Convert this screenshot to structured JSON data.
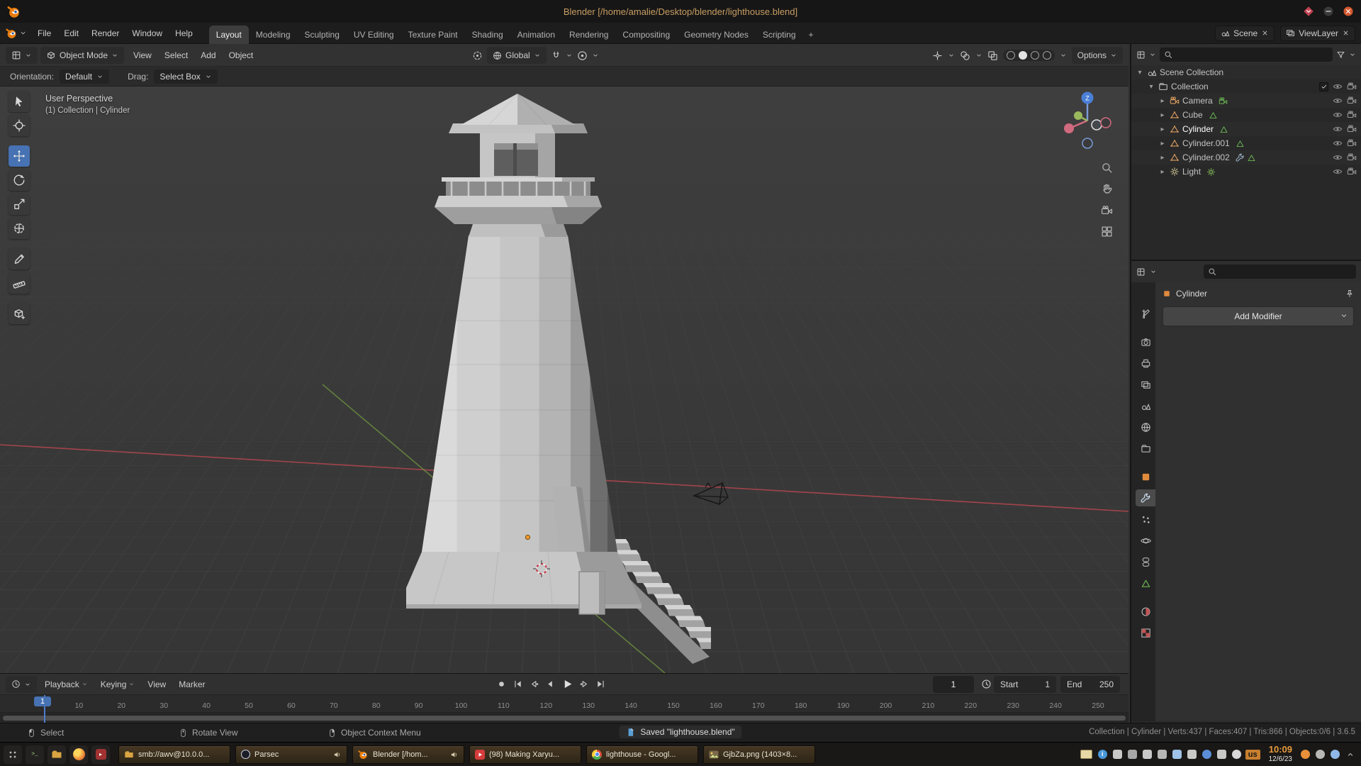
{
  "window": {
    "title": "Blender [/home/amalie/Desktop/blender/lighthouse.blend]"
  },
  "colors": {
    "accent": "#4772b3",
    "brand_orange": "#e87d0d"
  },
  "topbar": {
    "app_menus": [
      "File",
      "Edit",
      "Render",
      "Window",
      "Help"
    ],
    "workspaces": [
      "Layout",
      "Modeling",
      "Sculpting",
      "UV Editing",
      "Texture Paint",
      "Shading",
      "Animation",
      "Rendering",
      "Compositing",
      "Geometry Nodes",
      "Scripting"
    ],
    "active_workspace": "Layout",
    "add_workspace_label": "+",
    "scene_label": "Scene",
    "view_layer_label": "ViewLayer"
  },
  "viewport_header": {
    "mode": "Object Mode",
    "menus": [
      "View",
      "Select",
      "Add",
      "Object"
    ],
    "orientation": "Global",
    "options_label": "Options"
  },
  "tool_settings": {
    "orientation_label": "Orientation:",
    "orientation_value": "Default",
    "drag_label": "Drag:",
    "drag_value": "Select Box"
  },
  "viewport": {
    "overlay_line1": "User Perspective",
    "overlay_line2": "(1) Collection | Cylinder",
    "gizmo_z_label": "Z",
    "tools": [
      {
        "name": "select-box"
      },
      {
        "name": "cursor"
      },
      {
        "name": "move",
        "active": true
      },
      {
        "name": "rotate"
      },
      {
        "name": "scale"
      },
      {
        "name": "transform"
      },
      {
        "name": "annotate"
      },
      {
        "name": "measure"
      },
      {
        "name": "add-cube"
      }
    ],
    "active_tool": "move"
  },
  "outliner": {
    "search_placeholder": "",
    "rows": [
      {
        "label": "Scene Collection",
        "icon": "scene",
        "indent": 0,
        "disclosure": "down",
        "badges": [],
        "right": []
      },
      {
        "label": "Collection",
        "icon": "collection",
        "indent": 1,
        "disclosure": "down",
        "badges": [],
        "right": [
          "check",
          "eye",
          "cam"
        ]
      },
      {
        "label": "Camera",
        "icon": "camera",
        "indent": 2,
        "disclosure": "right",
        "badges": [
          "camera-data"
        ],
        "right": [
          "eye",
          "cam"
        ]
      },
      {
        "label": "Cube",
        "icon": "mesh",
        "indent": 2,
        "disclosure": "right",
        "badges": [
          "mesh-data"
        ],
        "right": [
          "eye",
          "cam"
        ]
      },
      {
        "label": "Cylinder",
        "icon": "mesh",
        "indent": 2,
        "disclosure": "right",
        "badges": [
          "mesh-data"
        ],
        "right": [
          "eye",
          "cam"
        ],
        "active": true
      },
      {
        "label": "Cylinder.001",
        "icon": "mesh",
        "indent": 2,
        "disclosure": "right",
        "badges": [
          "mesh-data"
        ],
        "right": [
          "eye",
          "cam"
        ]
      },
      {
        "label": "Cylinder.002",
        "icon": "mesh",
        "indent": 2,
        "disclosure": "right",
        "badges": [
          "modifier",
          "mesh-data"
        ],
        "right": [
          "eye",
          "cam"
        ]
      },
      {
        "label": "Light",
        "icon": "light",
        "indent": 2,
        "disclosure": "right",
        "badges": [
          "light-data"
        ],
        "right": [
          "eye",
          "cam"
        ]
      }
    ]
  },
  "properties": {
    "search_placeholder": "",
    "breadcrumb": "Cylinder",
    "add_modifier_label": "Add Modifier",
    "active_tab": "modifiers",
    "tabs": [
      {
        "name": "tool"
      },
      {
        "name": "render"
      },
      {
        "name": "output"
      },
      {
        "name": "view-layer"
      },
      {
        "name": "scene"
      },
      {
        "name": "world"
      },
      {
        "name": "collection"
      },
      {
        "name": "object"
      },
      {
        "name": "modifiers",
        "active": true
      },
      {
        "name": "particles"
      },
      {
        "name": "physics"
      },
      {
        "name": "constraints"
      },
      {
        "name": "object-data"
      },
      {
        "name": "material"
      },
      {
        "name": "texture"
      }
    ]
  },
  "timeline": {
    "menus": [
      "Playback",
      "Keying",
      "View",
      "Marker"
    ],
    "current_frame": "1",
    "playhead_frame": 1,
    "start_label": "Start",
    "start_value": "1",
    "end_label": "End",
    "end_value": "250",
    "tick_first": 10,
    "tick_last": 250,
    "tick_step": 10
  },
  "statusbar": {
    "hints": [
      {
        "icon": "mouse-left",
        "label": "Select"
      },
      {
        "icon": "mouse-middle",
        "label": "Rotate View"
      },
      {
        "icon": "mouse-right",
        "label": "Object Context Menu"
      }
    ],
    "notification": "Saved \"lighthouse.blend\"",
    "stats": "Collection | Cylinder | Verts:437 | Faces:407 | Tris:866 | Objects:0/6 | 3.6.5"
  },
  "taskbar": {
    "launchers": [
      {
        "name": "app-menu"
      },
      {
        "name": "terminal"
      },
      {
        "name": "files"
      },
      {
        "name": "firefox"
      },
      {
        "name": "media-player"
      }
    ],
    "windows": [
      {
        "label": "smb://awv@10.0.0...",
        "app": "folder",
        "audio": false
      },
      {
        "label": "Parsec",
        "app": "parsec",
        "audio": true
      },
      {
        "label": "Blender [/hom...",
        "app": "blender",
        "audio": true
      },
      {
        "label": "(98) Making Xaryu...",
        "app": "youtube",
        "audio": false
      },
      {
        "label": "lighthouse - Googl...",
        "app": "chrome",
        "audio": false
      },
      {
        "label": "GjbZa.png (1403×8...",
        "app": "image",
        "audio": false
      }
    ],
    "tray": [
      {
        "name": "notes",
        "color": "#e7d9a5",
        "shape": "note"
      },
      {
        "name": "info",
        "color": "#4a98d8",
        "shape": "circle",
        "glyph": "i"
      },
      {
        "name": "media",
        "color": "#c9c9c9",
        "shape": "square"
      },
      {
        "name": "screenshot",
        "color": "#a8a8a8",
        "shape": "square"
      },
      {
        "name": "volume",
        "color": "#c9c9c9",
        "shape": "square"
      },
      {
        "name": "pause",
        "color": "#b8b8b8",
        "shape": "square"
      },
      {
        "name": "display",
        "color": "#9fc3e8",
        "shape": "square"
      },
      {
        "name": "network",
        "color": "#c9c9c9",
        "shape": "square"
      },
      {
        "name": "bluetooth",
        "color": "#5a8fd8",
        "shape": "circle"
      },
      {
        "name": "battery",
        "color": "#c9c9c9",
        "shape": "square"
      },
      {
        "name": "cloud",
        "color": "#d8d8d8",
        "shape": "circle"
      }
    ],
    "keyboard_layout": "us",
    "time": "10:09",
    "date": "12/6/23",
    "tray_right": [
      {
        "name": "messages",
        "color": "#e8913a",
        "shape": "circle"
      },
      {
        "name": "settings",
        "color": "#b8b8b8",
        "shape": "circle"
      },
      {
        "name": "shield",
        "color": "#8fb8e8",
        "shape": "circle"
      },
      {
        "name": "expand",
        "color": "#c9c9c9",
        "shape": "chevron"
      }
    ]
  }
}
